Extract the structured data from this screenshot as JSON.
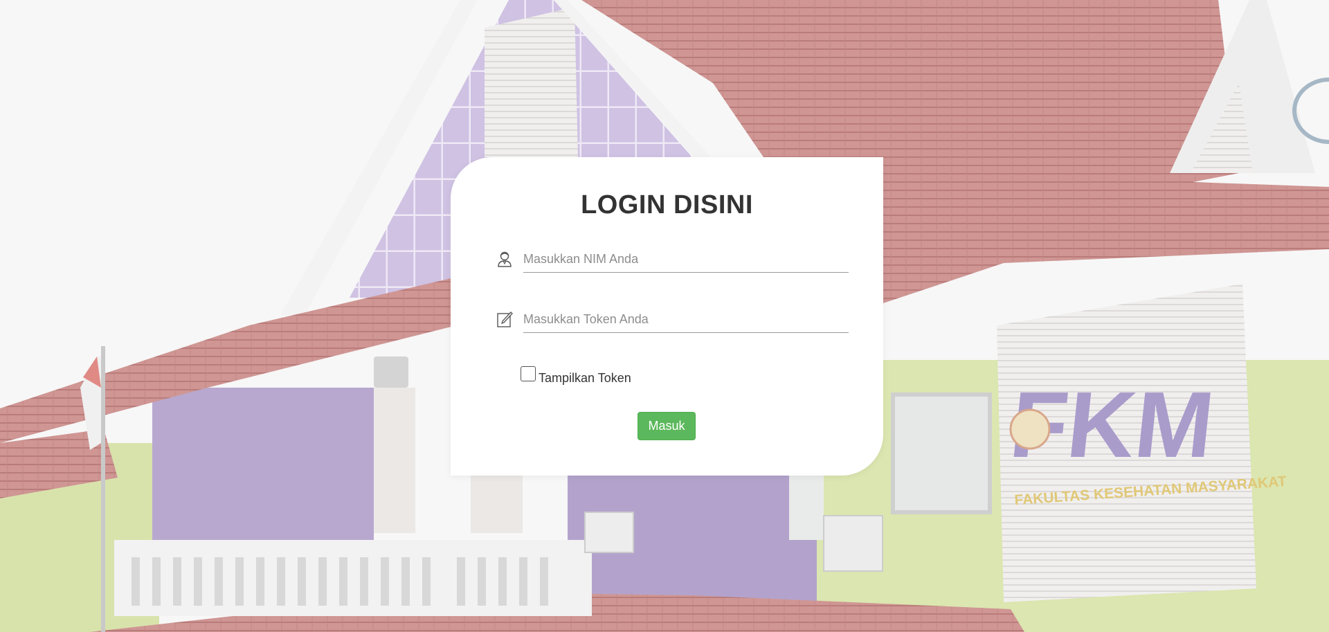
{
  "login": {
    "title": "LOGIN DISINI",
    "nim": {
      "placeholder": "Masukkan NIM Anda",
      "value": "",
      "icon": "user-icon"
    },
    "token": {
      "placeholder": "Masukkan Token Anda",
      "value": "",
      "icon": "edit-icon"
    },
    "show_token_label": "Tampilkan Token",
    "show_token_checked": false,
    "submit_label": "Masuk"
  },
  "background": {
    "sign_text": "FKM",
    "sign_subtext": "FAKULTAS KESEHATAN MASYARAKAT"
  },
  "colors": {
    "submit": "#5cb85c",
    "title": "#333333",
    "card": "#ffffff"
  }
}
